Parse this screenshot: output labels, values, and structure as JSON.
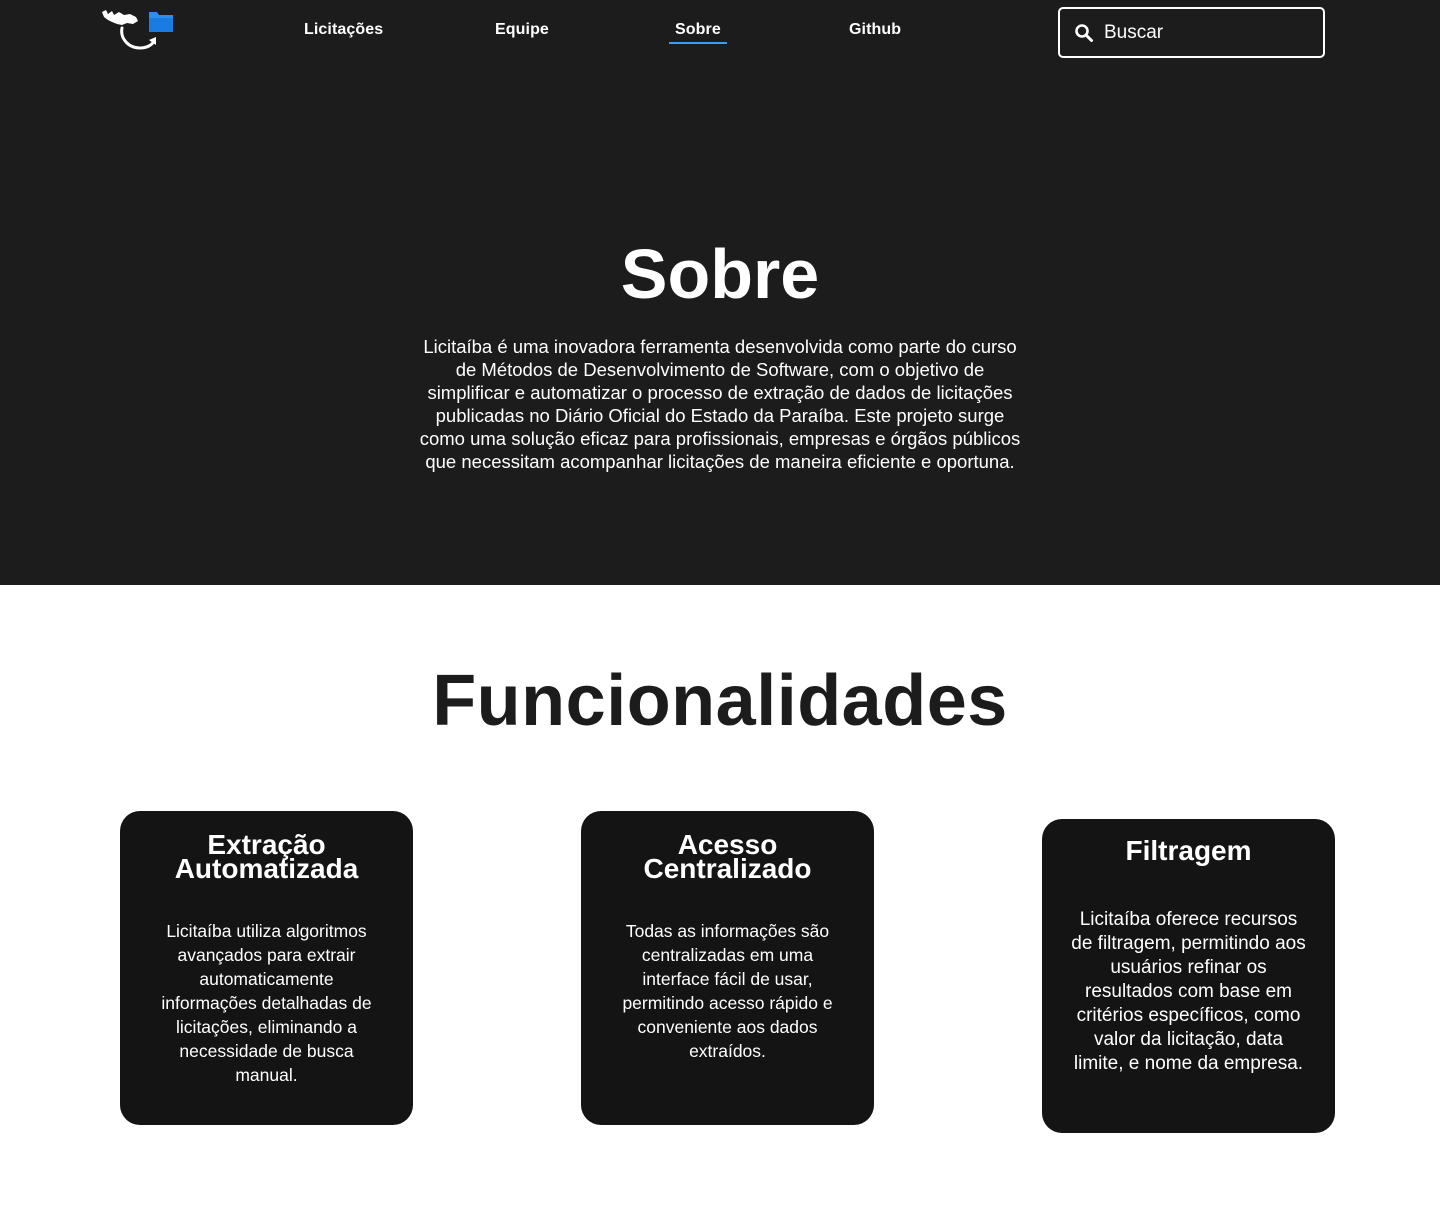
{
  "header": {
    "logo_alt": "Licitaíba",
    "nav": [
      {
        "label": "Licitações"
      },
      {
        "label": "Equipe"
      },
      {
        "label": "Sobre",
        "active": true
      },
      {
        "label": "Github"
      }
    ],
    "search": {
      "placeholder": "Buscar"
    }
  },
  "about": {
    "title": "Sobre",
    "text": "Licitaíba é uma inovadora ferramenta desenvolvida como parte do curso de Métodos de Desenvolvimento de Software, com o objetivo de simplificar e automatizar o processo de extração de dados de licitações publicadas no Diário Oficial do Estado da Paraíba. Este projeto surge como uma solução eficaz para profissionais, empresas e órgãos públicos que necessitam acompanhar licitações de maneira eficiente e oportuna."
  },
  "features": {
    "title": "Funcionalidades",
    "cards": [
      {
        "title": "Extração Automatizada",
        "text": "Licitaíba utiliza algoritmos avançados para extrair automaticamente informações detalhadas de licitações, eliminando a necessidade de busca manual."
      },
      {
        "title": "Acesso Centralizado",
        "text": "Todas as informações são centralizadas em uma interface fácil de usar, permitindo acesso rápido e conveniente aos dados extraídos."
      },
      {
        "title": "Filtragem",
        "text": "Licitaíba oferece recursos de filtragem, permitindo aos usuários refinar os resultados com base em critérios específicos, como valor da licitação, data limite, e nome da empresa."
      }
    ]
  },
  "colors": {
    "hero_bg": "#1c1c1c",
    "card_bg": "#141414",
    "accent": "#3b9bf5",
    "text_light": "#ffffff",
    "text_dark": "#1c1c1c"
  }
}
